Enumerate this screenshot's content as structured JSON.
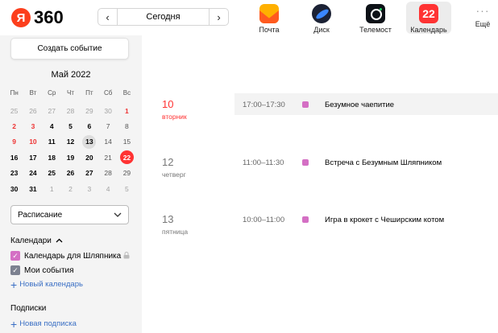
{
  "header": {
    "logo_letter": "Я",
    "logo_text": "360",
    "prev_label": "‹",
    "next_label": "›",
    "today_label": "Сегодня",
    "apps": [
      {
        "label": "Почта",
        "icon": "mail-icon"
      },
      {
        "label": "Диск",
        "icon": "disk-icon"
      },
      {
        "label": "Телемост",
        "icon": "telemost-icon"
      },
      {
        "label": "Календарь",
        "icon": "calendar-icon",
        "badge": "22"
      }
    ],
    "more_dots": "···",
    "more_label": "Ещё"
  },
  "sidebar": {
    "create_label": "Создать событие",
    "month_title": "Май 2022",
    "weekdays": [
      "Пн",
      "Вт",
      "Ср",
      "Чт",
      "Пт",
      "Сб",
      "Вс"
    ],
    "days": [
      "25",
      "26",
      "27",
      "28",
      "29",
      "30",
      "1",
      "2",
      "3",
      "4",
      "5",
      "6",
      "7",
      "8",
      "9",
      "10",
      "11",
      "12",
      "13",
      "14",
      "15",
      "16",
      "17",
      "18",
      "19",
      "20",
      "21",
      "22",
      "23",
      "24",
      "25",
      "26",
      "27",
      "28",
      "29",
      "30",
      "31",
      "1",
      "2",
      "3",
      "4",
      "5"
    ],
    "view_select": "Расписание",
    "calendars_title": "Календари",
    "calendars": [
      {
        "label": "Календарь для Шляпника",
        "color": "#d46fc4"
      },
      {
        "label": "Мои события",
        "color": "#7c8190"
      }
    ],
    "new_calendar": "Новый календарь",
    "subscriptions_title": "Подписки",
    "new_subscription": "Новая подписка"
  },
  "schedule": [
    {
      "day": "10",
      "weekday": "вторник",
      "time": "17:00–17:30",
      "title": "Безумное чаепитие",
      "color": "#d46fc4"
    },
    {
      "day": "12",
      "weekday": "четверг",
      "time": "11:00–11:30",
      "title": "Встреча с Безумным Шляпником",
      "color": "#d46fc4"
    },
    {
      "day": "13",
      "weekday": "пятница",
      "time": "10:00–11:00",
      "title": "Игра в крокет с Чеширским котом",
      "color": "#d46fc4"
    }
  ],
  "colors": {
    "accent_red": "#ff3333",
    "link_blue": "#3a6fc4",
    "event_pink": "#d46fc4"
  }
}
